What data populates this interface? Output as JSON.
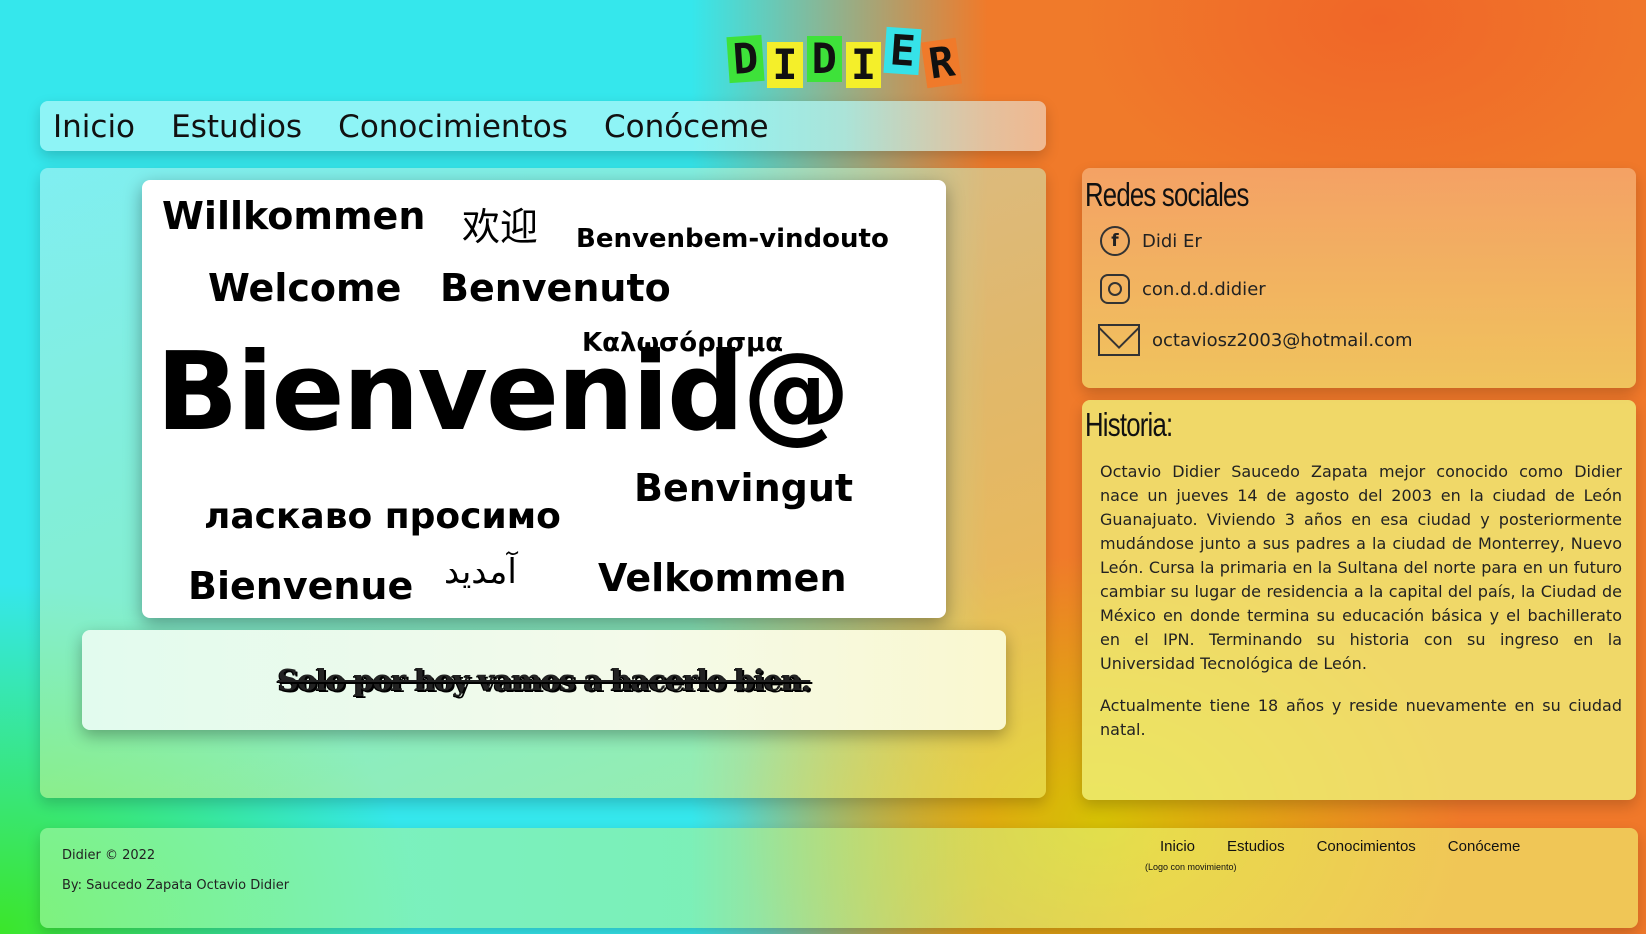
{
  "logo": {
    "letters": [
      "D",
      "I",
      "D",
      "I",
      "E",
      "R"
    ],
    "colors": [
      "#3ee23a",
      "#f4ef2a",
      "#3ee23a",
      "#f4ef2a",
      "#36e2e8",
      "#f07a2a"
    ]
  },
  "nav": {
    "items": [
      "Inicio",
      "Estudios",
      "Conocimientos",
      "Conóceme"
    ]
  },
  "welcome": {
    "words": {
      "willkommen": "Willkommen",
      "chinese": "欢迎",
      "portuguese": "Benvenbem-vindouto",
      "welcome": "Welcome",
      "benvenuto": "Benvenuto",
      "greek": "Καλωσόρισμα",
      "main": "Bienvenid@",
      "ukrainian": "ласкаво просимо",
      "benvingut": "Benvingut",
      "bienvenue": "Bienvenue",
      "persian": "آمدید",
      "velkommen": "Velkommen"
    },
    "motto": "Solo por hoy vamos a hacerlo bien."
  },
  "social": {
    "title": "Redes sociales",
    "facebook": "Didi Er",
    "instagram": "con.d.d.didier",
    "email": "octaviosz2003@hotmail.com",
    "icons": [
      "facebook-icon",
      "instagram-icon",
      "mail-icon"
    ]
  },
  "history": {
    "title": "Historia:",
    "paragraph1": "Octavio Didier Saucedo Zapata mejor conocido como Didier nace un jueves 14 de agosto del 2003 en la ciudad de León Guanajuato. Viviendo 3 años en esa ciudad y posteriormente mudándose junto a sus padres a la ciudad de Monterrey, Nuevo León. Cursa la primaria en la Sultana del norte para en un futuro cambiar su lugar de residencia a la capital del país, la Ciudad de México en donde termina su educación básica y el bachillerato en el IPN. Terminando su historia con su ingreso en la Universidad Tecnológica de León.",
    "paragraph2": "Actualmente tiene 18 años y reside nuevamente en su ciudad natal."
  },
  "footer": {
    "copyright": "Didier © 2022",
    "author": "By: Saucedo Zapata Octavio Didier",
    "nav": [
      "Inicio",
      "Estudios",
      "Conocimientos",
      "Conóceme"
    ],
    "note": "(Logo con movimiento)"
  }
}
